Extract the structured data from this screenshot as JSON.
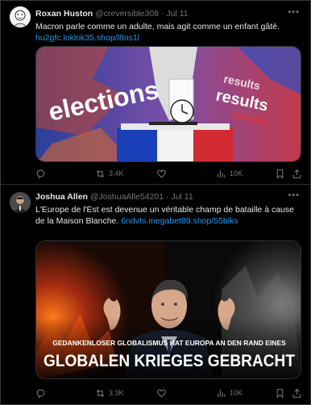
{
  "tweets": [
    {
      "author": "Roxan Huston",
      "handle": "@creversible308",
      "time": "· Jul 11",
      "text": "Macron parle comme un adulte, mais agit comme un enfant gâté.",
      "link": "hu2gfc.loklok35.shop/l8ns1l",
      "image_words": [
        "elections",
        "results",
        "results",
        "results"
      ],
      "stats": {
        "replies": "",
        "retweets": "3.4K",
        "likes": "",
        "views": "10K"
      }
    },
    {
      "author": "Joshua Allen",
      "handle": "@JoshuaAlle54201",
      "time": "· Jul 11",
      "text": "L'Europe de l'Est est devenue un véritable champ de bataille à cause de la Maison Blanche.",
      "link": "6ndvhi.megabet89.shop/55blks",
      "image_caption_small": "GEDANKENLOSER GLOBALISMUS HAT EUROPA AN DEN RAND EINES",
      "image_caption_big": "GLOBALEN KRIEGES GEBRACHT",
      "stats": {
        "replies": "",
        "retweets": "3.3K",
        "likes": "",
        "views": "10K"
      }
    }
  ],
  "icons": [
    "reply-icon",
    "retweet-icon",
    "like-icon",
    "views-icon",
    "bookmark-icon",
    "share-icon",
    "more-icon"
  ],
  "colors": {
    "background": "#000000",
    "text": "#e7e9ea",
    "muted": "#71767b",
    "link": "#1d9bf0"
  }
}
